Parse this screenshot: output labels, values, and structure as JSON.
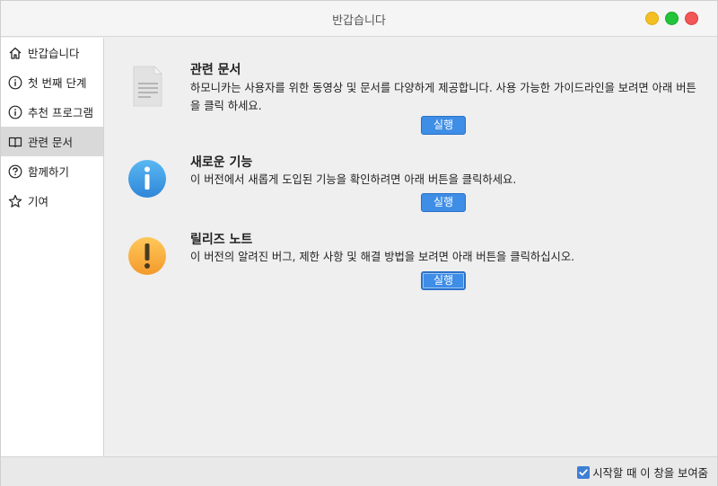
{
  "window": {
    "title": "반갑습니다"
  },
  "sidebar": {
    "items": [
      {
        "label": "반갑습니다",
        "icon": "home-icon",
        "active": false
      },
      {
        "label": "첫 번째 단계",
        "icon": "info-circle-icon",
        "active": false
      },
      {
        "label": "추천 프로그램",
        "icon": "info-circle-icon",
        "active": false
      },
      {
        "label": "관련 문서",
        "icon": "book-icon",
        "active": true
      },
      {
        "label": "함께하기",
        "icon": "question-circle-icon",
        "active": false
      },
      {
        "label": "기여",
        "icon": "star-icon",
        "active": false
      }
    ]
  },
  "main": {
    "sections": [
      {
        "title": "관련 문서",
        "description": "하모니카는 사용자를 위한 동영상 및 문서를 다양하게 제공합니다. 사용 가능한 가이드라인을 보려면 아래 버튼을 클릭 하세요.",
        "button_label": "실행",
        "icon": "document-icon"
      },
      {
        "title": "새로운 기능",
        "description": "이 버전에서 새롭게 도입된 기능을 확인하려면 아래 버튼을 클릭하세요.",
        "button_label": "실행",
        "icon": "info-icon"
      },
      {
        "title": "릴리즈 노트",
        "description": "이 버전의 알려진 버그, 제한 사항 및 해결 방법을 보려면 아래 버튼을 클릭하십시오.",
        "button_label": "실행",
        "icon": "warning-icon"
      }
    ]
  },
  "footer": {
    "startup_label": "시작할 때 이 창을 보여줌",
    "startup_checked": true
  },
  "colors": {
    "accent": "#3e8de6",
    "close": "#f25656",
    "minimize": "#f4bf22",
    "maximize": "#22c43a"
  }
}
